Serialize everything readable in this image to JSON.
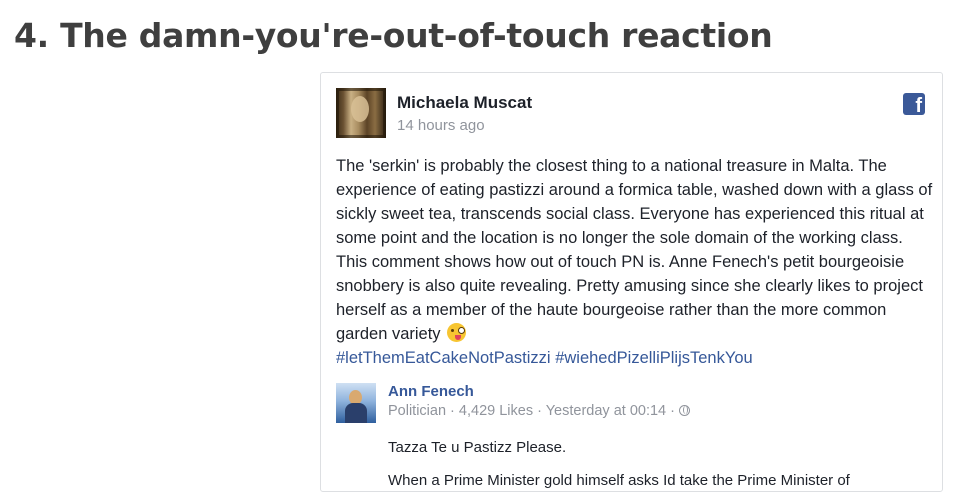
{
  "heading": "4. The damn-you're-out-of-touch reaction",
  "post": {
    "author": "Michaela Muscat",
    "timestamp": "14 hours ago",
    "body": "The 'serkin' is probably the closest thing to a national treasure in Malta. The experience of eating pastizzi around a formica table, washed down with a glass of sickly sweet tea, transcends social class. Everyone has experienced this ritual at some point and the location is no longer the sole domain of the working class. This comment shows how out of touch PN is. Anne Fenech's petit bourgeoisie snobbery is also quite revealing. Pretty amusing since she clearly likes to project herself as a member of the haute bourgeoise rather than the more common garden variety",
    "hashtags": [
      "#letThemEatCakeNotPastizzi",
      "#wiehedPizelliPlijsTenkYou"
    ],
    "emoji": "winking-tongue-face",
    "platform_icon": "facebook-icon",
    "platform_icon_glyph": "f"
  },
  "shared_post": {
    "author": "Ann Fenech",
    "category": "Politician",
    "likes": "4,429 Likes",
    "time": "Yesterday at 00:14",
    "separator": " · ",
    "privacy_icon": "globe-icon",
    "line1": "Tazza Te u Pastizz Please.",
    "line2": "When a Prime Minister gold himself asks Id take the Prime Minister of"
  },
  "colors": {
    "heading": "#3f3f3f",
    "link": "#365899",
    "text": "#1d2129",
    "meta": "#90949c",
    "facebook": "#3b5998"
  }
}
